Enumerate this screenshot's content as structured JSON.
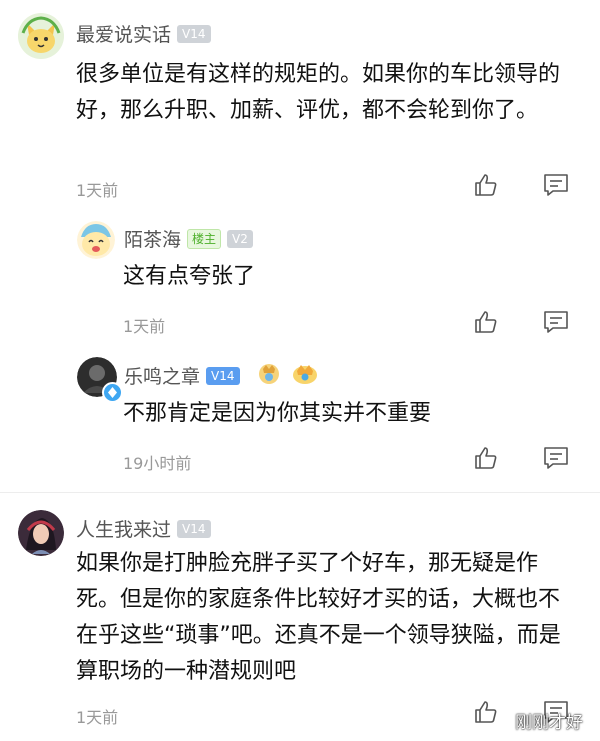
{
  "comments": [
    {
      "username": "最爱说实话",
      "level": "V14",
      "text": "很多单位是有这样的规矩的。如果你的车比领导的好，那么升职、加薪、评优，都不会轮到你了。",
      "time": "1天前",
      "replies": [
        {
          "username": "陌茶海",
          "owner_badge": "楼主",
          "level": "V2",
          "text": "这有点夸张了",
          "time": "1天前"
        },
        {
          "username": "乐鸣之章",
          "level": "V14",
          "text": "不那肯定是因为你其实并不重要",
          "time": "19小时前"
        }
      ]
    },
    {
      "username": "人生我来过",
      "level": "V14",
      "text": "如果你是打肿脸充胖子买了个好车，那无疑是作死。但是你的家庭条件比较好才买的话，大概也不在乎这些“琐事”吧。还真不是一个领导狭隘，而是算职场的一种潜规则吧",
      "time": "1天前"
    }
  ],
  "watermark": "刚刚才好",
  "colors": {
    "name": "#555555",
    "text": "#111111",
    "time": "#999999",
    "level_badge": "#cfd3d8",
    "level_badge_active": "#5a9df0",
    "owner_badge_text": "#4caf2a",
    "owner_badge_bg": "#e8f7df"
  }
}
